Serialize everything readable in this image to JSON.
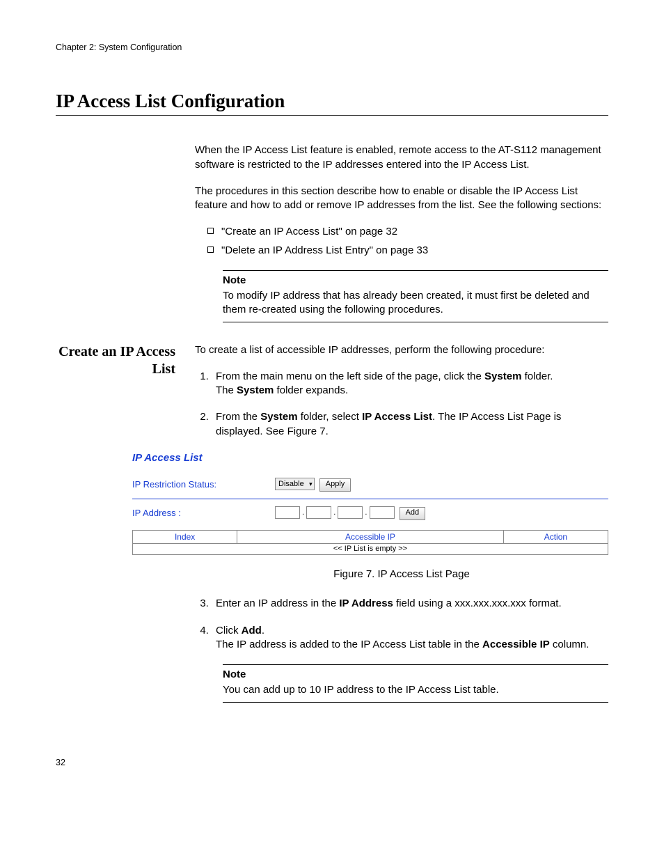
{
  "header": {
    "chapter": "Chapter 2: System Configuration"
  },
  "title": "IP Access List Configuration",
  "intro": {
    "p1": "When the IP Access List feature is enabled, remote access to the AT-S112 management software is restricted to the IP addresses entered into the IP Access List.",
    "p2": "The procedures in this section describe how to enable or disable the IP Access List feature and how to add or remove IP addresses from the list. See the following sections:"
  },
  "bullets": {
    "b1": "\"Create an IP Access List\" on page 32",
    "b2": "\"Delete an IP Address List Entry\" on page 33"
  },
  "note1": {
    "label": "Note",
    "text": "To modify IP address that has already been created, it must first be deleted and them re-created using the following procedures."
  },
  "sideHeading": "Create an IP Access List",
  "sideIntro": "To create a list of accessible IP addresses, perform the following procedure:",
  "steps": {
    "s1a": "From the main menu on the left side of the page, click the ",
    "s1b": "System",
    "s1c": " folder.",
    "s1d": "The ",
    "s1e": "System",
    "s1f": " folder expands.",
    "s2a": "From the ",
    "s2b": "System",
    "s2c": " folder, select ",
    "s2d": "IP Access List",
    "s2e": ". The IP Access List Page is displayed. See Figure 7.",
    "s3a": "Enter an IP address in the ",
    "s3b": "IP Address",
    "s3c": " field using a xxx.xxx.xxx.xxx format.",
    "s4a": "Click ",
    "s4b": "Add",
    "s4c": ".",
    "s4d": "The IP address is added to the IP Access List table in the ",
    "s4e": "Accessible IP",
    "s4f": " column."
  },
  "figure": {
    "title": "IP Access List",
    "restrictionLabel": "IP Restriction Status:",
    "restrictionValue": "Disable",
    "applyBtn": "Apply",
    "ipLabel": "IP Address :",
    "addBtn": "Add",
    "th1": "Index",
    "th2": "Accessible IP",
    "th3": "Action",
    "empty": "<< IP List is empty >>",
    "caption": "Figure 7. IP Access List Page"
  },
  "note2": {
    "label": "Note",
    "text": "You can add up to 10 IP address to the IP Access List table."
  },
  "pageNumber": "32"
}
